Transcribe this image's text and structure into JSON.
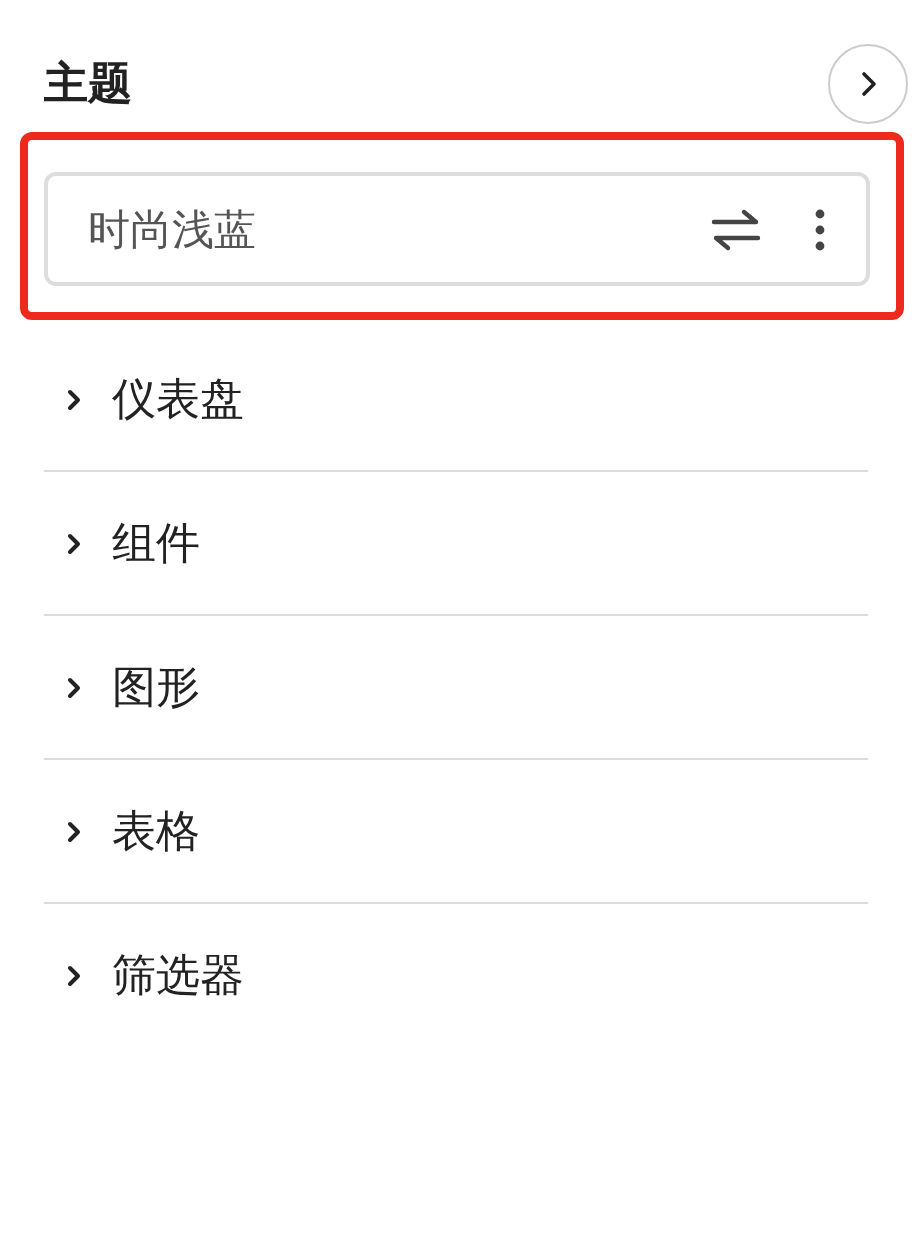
{
  "header": {
    "title": "主题"
  },
  "theme": {
    "value": "时尚浅蓝",
    "highlighted": true
  },
  "sections": [
    {
      "label": "仪表盘",
      "expanded": false
    },
    {
      "label": "组件",
      "expanded": false
    },
    {
      "label": "图形",
      "expanded": false
    },
    {
      "label": "表格",
      "expanded": false
    },
    {
      "label": "筛选器",
      "expanded": false
    }
  ]
}
